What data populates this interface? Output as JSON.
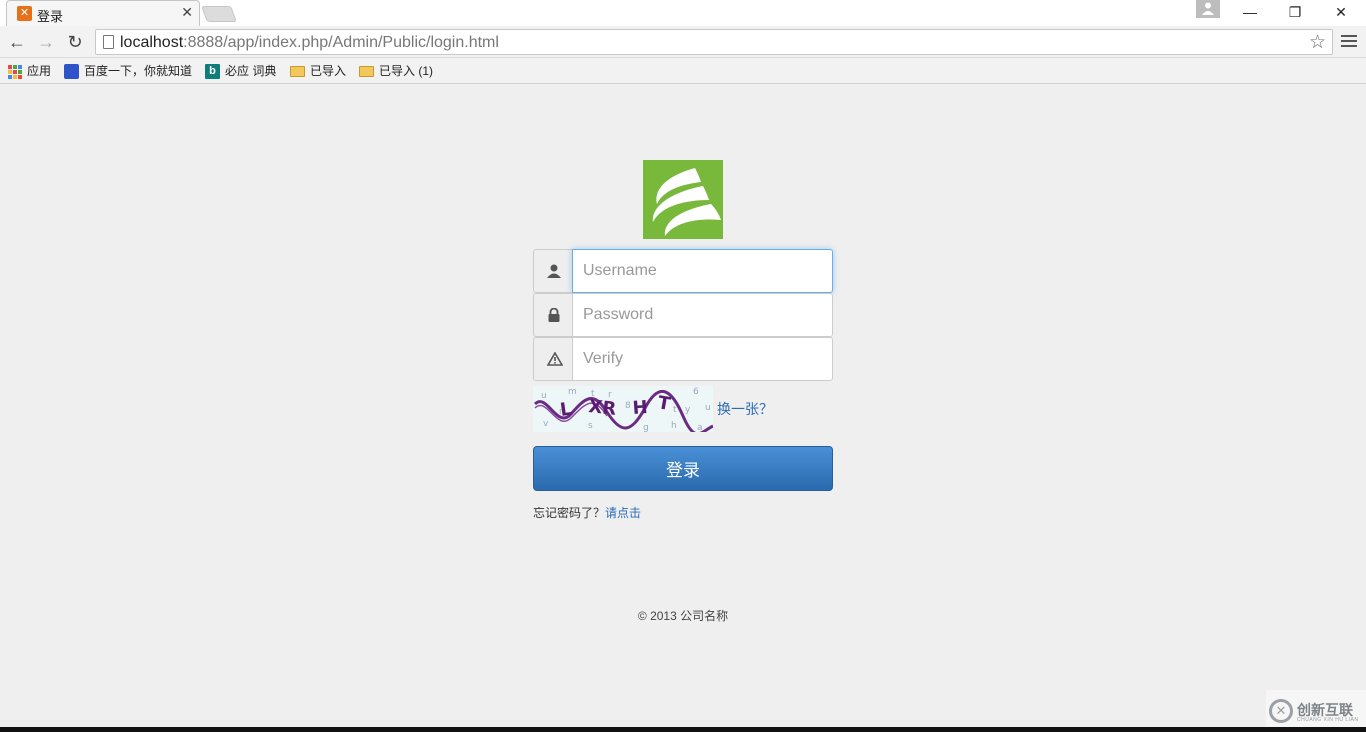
{
  "browser": {
    "tab_title": "登录",
    "tab_favicon": "xampp-icon",
    "url_host": "localhost",
    "url_path": ":8888/app/index.php/Admin/Public/login.html",
    "bookmarks": [
      {
        "label": "应用",
        "icon": "apps-grid-icon"
      },
      {
        "label": "百度一下，你就知道",
        "icon": "baidu-paw-icon"
      },
      {
        "label": "必应 词典",
        "icon": "bing-icon"
      },
      {
        "label": "已导入",
        "icon": "folder-icon"
      },
      {
        "label": "已导入 (1)",
        "icon": "folder-icon"
      }
    ]
  },
  "login": {
    "username_placeholder": "Username",
    "password_placeholder": "Password",
    "verify_placeholder": "Verify",
    "refresh_captcha": "换一张？",
    "submit_label": "登录",
    "forgot_text": "忘记密码了？",
    "forgot_link": "请点击"
  },
  "footer": {
    "copyright": "© 2013 公司名称"
  },
  "watermark": {
    "text": "创新互联",
    "sub": "CHUANG XIN HU LIAN"
  },
  "colors": {
    "logo_green": "#78b93c",
    "button_blue": "#2a6aae",
    "link_blue": "#2a6db5"
  }
}
